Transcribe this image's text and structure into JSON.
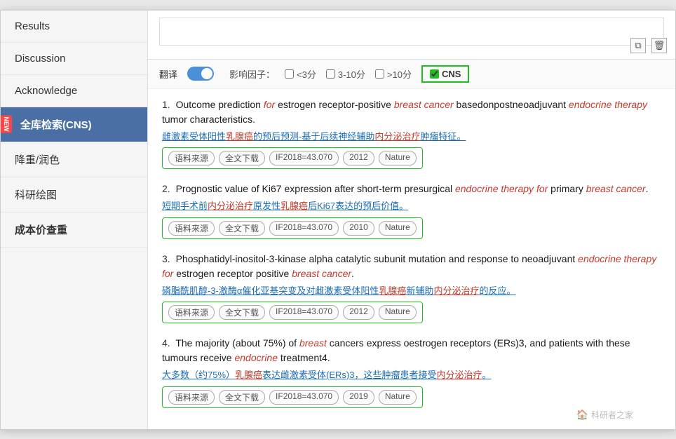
{
  "sidebar": {
    "items": [
      {
        "id": "results",
        "label": "Results",
        "active": false,
        "new": false
      },
      {
        "id": "discussion",
        "label": "Discussion",
        "active": false,
        "new": false
      },
      {
        "id": "acknowledge",
        "label": "Acknowledge",
        "active": false,
        "new": false
      },
      {
        "id": "cns-search",
        "label": "全库检索(CNS)",
        "active": true,
        "new": true
      },
      {
        "id": "reweight",
        "label": "降重/润色",
        "active": false,
        "new": false
      },
      {
        "id": "drawing",
        "label": "科研绘图",
        "active": false,
        "new": false
      },
      {
        "id": "cost",
        "label": "成本价查重",
        "active": false,
        "new": false
      }
    ]
  },
  "filter": {
    "translate_label": "翻译",
    "if_label": "影响因子：",
    "opt1": "<3分",
    "opt2": "3-10分",
    "opt3": ">10分",
    "cns_label": "CNS"
  },
  "results": [
    {
      "index": 1,
      "title_pre": "Outcome prediction ",
      "title_italic1": "for",
      "title_mid1": " estrogen receptor-positive ",
      "title_italic2": "breast cancer",
      "title_mid2": " basedonpostneoadjuvant ",
      "title_italic3": "endocrine therapy",
      "title_end": " tumor characteristics.",
      "translation": "雌激素受体阳性乳腺癌的预后预测-基于后续神经辅助内分泌治疗肿瘤特征。",
      "tags": [
        "语料来源",
        "全文下载",
        "IF2018=43.070",
        "2012",
        "Nature"
      ]
    },
    {
      "index": 2,
      "title_pre": "Prognostic value of Ki67 expression after short-term presurgical ",
      "title_italic1": "endocrine therapy for",
      "title_mid1": " primary ",
      "title_italic2": "breast cancer",
      "title_end": ".",
      "translation": "短期手术前内分泌治疗原发性乳腺癌后Ki67表达的预后价值。",
      "tags": [
        "语料来源",
        "全文下载",
        "IF2018=43.070",
        "2010",
        "Nature"
      ]
    },
    {
      "index": 3,
      "title_pre": "Phosphatidyl-inositol-3-kinase alpha catalytic subunit mutation and response to neoadjuvant ",
      "title_italic1": "endocrine therapy for",
      "title_mid1": " estrogen receptor positive ",
      "title_italic2": "breast cancer",
      "title_end": ".",
      "translation": "磷脂酰肌醇-3-激酶α催化亚基突变及对雌激素受体阳性乳腺癌新辅助内分泌治疗的反应。",
      "tags": [
        "语料来源",
        "全文下载",
        "IF2018=43.070",
        "2012",
        "Nature"
      ]
    },
    {
      "index": 4,
      "title_pre": "The majority (about 75%) of ",
      "title_italic1": "breast",
      "title_mid1": " cancers express oestrogen receptors (ERs)3, and patients with these tumours receive ",
      "title_italic2": "endocrine",
      "title_end": " treatment4.",
      "translation": "大多数（约75%）乳腺癌表达雌激素受体(ERs)3，这些肿瘤患者接受内分泌治疗。",
      "tags": [
        "语料来源",
        "全文下载",
        "IF2018=43.070",
        "2019",
        "Nature"
      ]
    }
  ],
  "watermark": "科研者之家"
}
